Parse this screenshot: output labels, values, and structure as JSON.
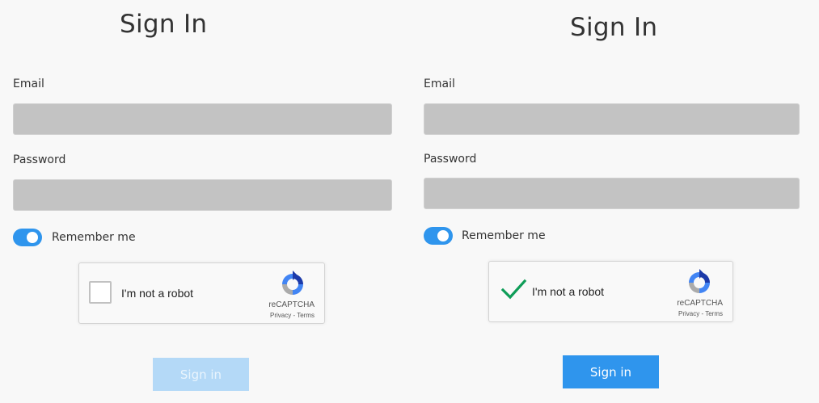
{
  "left": {
    "title": "Sign In",
    "email_label": "Email",
    "email_value": "",
    "password_label": "Password",
    "password_value": "",
    "remember_label": "Remember me",
    "remember_on": true,
    "captcha": {
      "text": "I'm not a robot",
      "checked": false,
      "brand": "reCAPTCHA",
      "links": "Privacy - Terms"
    },
    "signin_label": "Sign in",
    "signin_enabled": false
  },
  "right": {
    "title": "Sign In",
    "email_label": "Email",
    "email_value": "",
    "password_label": "Password",
    "password_value": "",
    "remember_label": "Remember me",
    "remember_on": true,
    "captcha": {
      "text": "I'm not a robot",
      "checked": true,
      "brand": "reCAPTCHA",
      "links": "Privacy - Terms"
    },
    "signin_label": "Sign in",
    "signin_enabled": true
  },
  "colors": {
    "accent": "#2f95ed",
    "accent_disabled": "#b4d9f7",
    "input_fill": "#c3c3c3",
    "check_green": "#0f9d58"
  },
  "icons": {
    "captcha_logo": "recaptcha-logo-icon",
    "check": "checkmark-icon"
  }
}
